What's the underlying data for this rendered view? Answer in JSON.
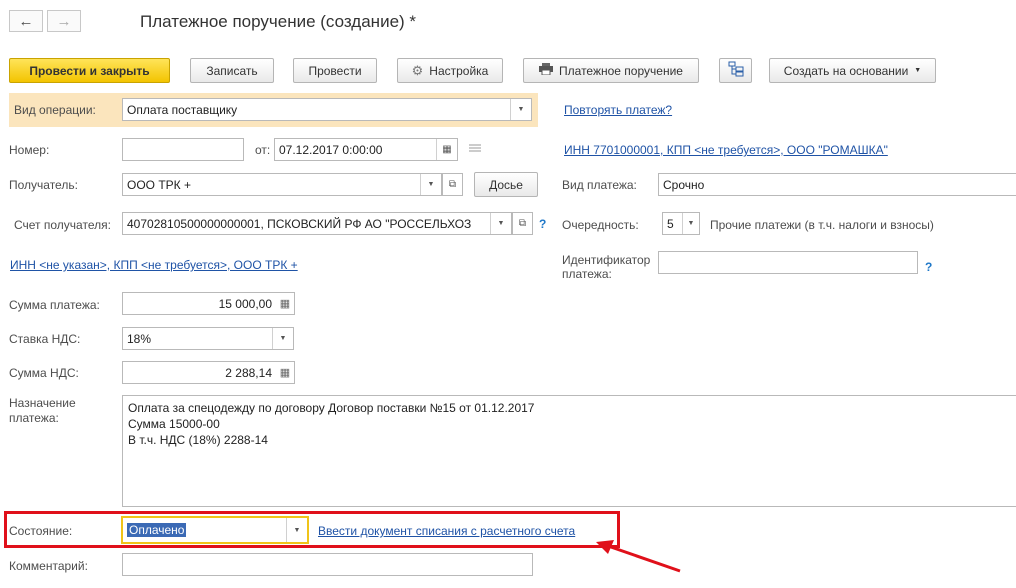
{
  "window": {
    "title": "Платежное поручение (создание) *"
  },
  "nav": {
    "back_icon": "←",
    "forward_icon": "→"
  },
  "toolbar": {
    "post_close": "Провести и закрыть",
    "save": "Записать",
    "post": "Провести",
    "settings": "Настройка",
    "print": "Платежное поручение",
    "create_based": "Создать на основании"
  },
  "form": {
    "operation_label": "Вид операции:",
    "operation_value": "Оплата поставщику",
    "repeat_link": "Повторять платеж?",
    "number_label": "Номер:",
    "number_value": "",
    "date_label": "от:",
    "date_value": "07.12.2017  0:00:00",
    "payer_link": "ИНН 7701000001, КПП <не требуется>, ООО \"РОМАШКА\"",
    "recipient_label": "Получатель:",
    "recipient_value": "ООО ТРК +",
    "dossier_button": "Досье",
    "payment_type_label": "Вид платежа:",
    "payment_type_value": "Срочно",
    "account_label": "Счет получателя:",
    "account_value": "40702810500000000001, ПСКОВСКИЙ РФ АО \"РОССЕЛЬХОЗ",
    "help_mark": "?",
    "priority_label": "Очередность:",
    "priority_value": "5",
    "priority_desc": "Прочие платежи (в т.ч. налоги и взносы)",
    "recipient_info_link": "ИНН <не указан>, КПП <не требуется>, ООО ТРК +",
    "payment_id_label_1": "Идентификатор",
    "payment_id_label_2": "платежа:",
    "payment_id_value": "",
    "amount_label": "Сумма платежа:",
    "amount_value": "15 000,00",
    "vat_rate_label": "Ставка НДС:",
    "vat_rate_value": "18%",
    "vat_amount_label": "Сумма НДС:",
    "vat_amount_value": "2 288,14",
    "purpose_label_1": "Назначение",
    "purpose_label_2": "платежа:",
    "purpose_line_1": "Оплата за спецодежду по договору Договор поставки №15 от 01.12.2017",
    "purpose_line_2": "Сумма 15000-00",
    "purpose_line_3": "В т.ч. НДС  (18%) 2288-14",
    "state_label": "Состояние:",
    "state_value": "Оплачено",
    "writeoff_link": "Ввести документ списания с расчетного счета",
    "comment_label": "Комментарий:",
    "comment_value": ""
  },
  "colors": {
    "highlight_frame": "#e0101a",
    "yellow_button": "#f5c800",
    "link": "#1f53a6"
  }
}
